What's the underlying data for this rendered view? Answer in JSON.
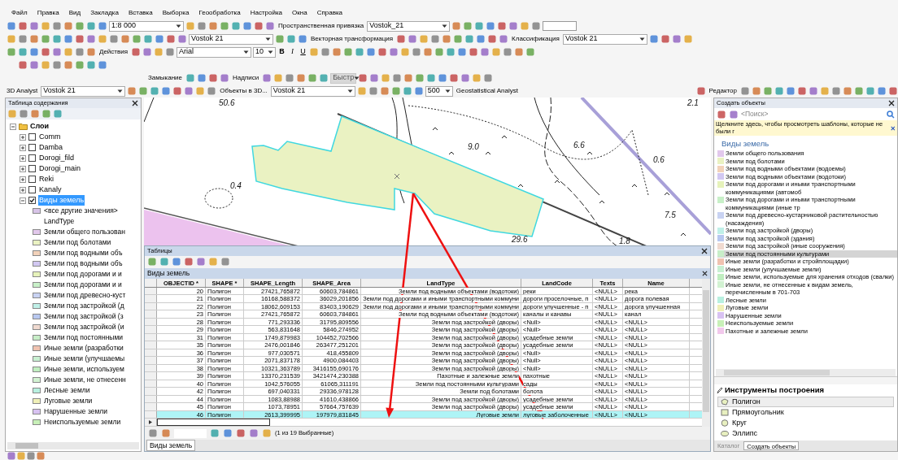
{
  "menu": [
    "Файл",
    "Правка",
    "Вид",
    "Закладка",
    "Вставка",
    "Выборка",
    "Геообработка",
    "Настройка",
    "Окна",
    "Справка"
  ],
  "toolbars": [
    {
      "items": [
        {
          "kind": "combo",
          "value": "1:8 000",
          "disabled": false
        },
        {
          "kind": "menu",
          "label": "Пространственная привязка"
        },
        {
          "kind": "combo",
          "value": "Vostok_21",
          "disabled": false
        }
      ]
    },
    {
      "items": [
        {
          "kind": "combo",
          "value": "Vostok 21",
          "disabled": false
        },
        {
          "kind": "menu",
          "label": "Векторная трансформация"
        },
        {
          "kind": "menu",
          "label": "Классификация"
        },
        {
          "kind": "combo",
          "value": "Vostok 21",
          "disabled": false
        }
      ]
    },
    {
      "items": [
        {
          "kind": "menu",
          "label": "Действия"
        },
        {
          "kind": "combo",
          "value": "Arial",
          "disabled": false
        },
        {
          "kind": "combo",
          "value": "10",
          "disabled": false
        },
        {
          "kind": "glyph",
          "text": "B"
        },
        {
          "kind": "glyph",
          "text": "I"
        },
        {
          "kind": "glyph",
          "text": "U"
        }
      ]
    },
    {
      "items": [
        {
          "kind": "menu",
          "label": "Замыкание"
        },
        {
          "kind": "menu",
          "label": "Надписи"
        },
        {
          "kind": "combo",
          "value": "Быстр",
          "disabled": true
        }
      ]
    },
    {
      "items": [
        {
          "kind": "menu",
          "label": "3D Analyst"
        },
        {
          "kind": "combo",
          "value": "Vostok 21",
          "disabled": false
        },
        {
          "kind": "menu",
          "label": "Объекты в 3D..."
        },
        {
          "kind": "combo",
          "value": "Vostok 21",
          "disabled": false
        },
        {
          "kind": "combo",
          "value": "500",
          "disabled": false
        },
        {
          "kind": "menu",
          "label": "Geostatistical Analyst"
        },
        {
          "kind": "menu",
          "label": "Редактор"
        }
      ]
    }
  ],
  "toc": {
    "title": "Таблица содержания",
    "root": "Слои",
    "expanded": true,
    "layers": [
      {
        "label": "Comm",
        "checked": false,
        "expanded": false,
        "selected": false
      },
      {
        "label": "Damba",
        "checked": false,
        "expanded": false,
        "selected": false
      },
      {
        "label": "Dorogi_fild",
        "checked": false,
        "expanded": false,
        "selected": false
      },
      {
        "label": "Dorogi_main",
        "checked": false,
        "expanded": false,
        "selected": false
      },
      {
        "label": "Reki",
        "checked": false,
        "expanded": false,
        "selected": false
      },
      {
        "label": "Kanaly",
        "checked": false,
        "expanded": false,
        "selected": false
      },
      {
        "label": "Виды земель",
        "checked": true,
        "expanded": true,
        "selected": true,
        "legend": [
          {
            "kind": "symbol",
            "label": "<все другие значения>",
            "color": "#d8c4e8"
          },
          {
            "kind": "heading",
            "label": "LandType"
          },
          {
            "kind": "symbol",
            "label": "Земли общего пользован",
            "color": "#e2c8ec"
          },
          {
            "kind": "symbol",
            "label": "Земли под болотами",
            "color": "#eaf2c2"
          },
          {
            "kind": "symbol",
            "label": "Земли под водными объ",
            "color": "#f2d2ba"
          },
          {
            "kind": "symbol",
            "label": "Земли под водными объ",
            "color": "#d2c8f2"
          },
          {
            "kind": "symbol",
            "label": "Земли под дорогами и и",
            "color": "#e6f2ba"
          },
          {
            "kind": "symbol",
            "label": "Земли под дорогами и и",
            "color": "#c8f0c8"
          },
          {
            "kind": "symbol",
            "label": "Земли под древесно-куст",
            "color": "#c8d2f2"
          },
          {
            "kind": "symbol",
            "label": "Земли под застройкой (д",
            "color": "#c0f0e8"
          },
          {
            "kind": "symbol",
            "label": "Земли под застройкой (з",
            "color": "#b8c8f0"
          },
          {
            "kind": "symbol",
            "label": "Земли под застройкой (и",
            "color": "#f0dad0"
          },
          {
            "kind": "symbol",
            "label": "Земли под постоянными",
            "color": "#c8eec8"
          },
          {
            "kind": "symbol",
            "label": "Иные земли (разработки",
            "color": "#f0c2b0"
          },
          {
            "kind": "symbol",
            "label": "Иные земли (улучшаемы",
            "color": "#c8f0d2"
          },
          {
            "kind": "symbol",
            "label": "Иные земли, используем",
            "color": "#c0eec0"
          },
          {
            "kind": "symbol",
            "label": "Иные земли, не отнесенн",
            "color": "#d2f2d2"
          },
          {
            "kind": "symbol",
            "label": "Лесные земли",
            "color": "#b8f0e0"
          },
          {
            "kind": "symbol",
            "label": "Луговые земли",
            "color": "#f0f0b8"
          },
          {
            "kind": "symbol",
            "label": "Нарушенные земли",
            "color": "#d8c2f2"
          },
          {
            "kind": "symbol",
            "label": "Неиспользуемые земли",
            "color": "#c8f0b8"
          }
        ]
      }
    ]
  },
  "map": {
    "labels": [
      "50.6",
      "9.0",
      "6.6",
      "0.6",
      "7.5",
      "29.6",
      "1.8",
      "2.1",
      "0.4"
    ]
  },
  "table": {
    "title": "Таблицы",
    "layer": "Виды земель",
    "columns": [
      "OBJECTID *",
      "SHAPE *",
      "SHAPE_Length",
      "SHAPE_Area",
      "LandType",
      "LandCode",
      "Texts",
      "Name"
    ],
    "rows": [
      {
        "selected": false,
        "cells": [
          "20",
          "Полигон",
          "27421,765872",
          "60603,784861",
          "Земли под водными объектами (водотоки)",
          "реки",
          "<NULL>",
          "река"
        ]
      },
      {
        "selected": false,
        "cells": [
          "21",
          "Полигон",
          "16168,588372",
          "36029,201856",
          "Земли под дорогами и иными транспортными коммуни",
          "дороги проселочные, п",
          "<NULL>",
          "дорога полевая"
        ]
      },
      {
        "selected": false,
        "cells": [
          "22",
          "Полигон",
          "18062,609153",
          "83403,190629",
          "Земли под дорогами и иными транспортными коммуни",
          "дороги улучшенные - п",
          "<NULL>",
          "дорога улучшенная"
        ]
      },
      {
        "selected": false,
        "cells": [
          "23",
          "Полигон",
          "27421,765872",
          "60603,784861",
          "Земли под водными объектами (водотоки)",
          "каналы и канавы",
          "<NULL>",
          "канал"
        ]
      },
      {
        "selected": false,
        "cells": [
          "28",
          "Полигон",
          "771,293336",
          "31795,809556",
          "Земли под застройкой (дворы)",
          "<Null>",
          "<NULL>",
          "<NULL>"
        ]
      },
      {
        "selected": false,
        "cells": [
          "29",
          "Полигон",
          "563,831648",
          "5846,274952",
          "Земли под застройкой (дворы)",
          "<Null>",
          "<NULL>",
          "<NULL>"
        ]
      },
      {
        "selected": false,
        "cells": [
          "31",
          "Полигон",
          "1749,879983",
          "104452,702566",
          "Земли под застройкой (дворы)",
          "усадебные земли",
          "<NULL>",
          "<NULL>"
        ]
      },
      {
        "selected": false,
        "cells": [
          "35",
          "Полигон",
          "2476,001846",
          "263477,251201",
          "Земли под застройкой (дворы)",
          "усадебные земли",
          "<NULL>",
          "<NULL>"
        ]
      },
      {
        "selected": false,
        "cells": [
          "36",
          "Полигон",
          "977,030571",
          "418,455809",
          "Земли под застройкой (дворы)",
          "<Null>",
          "<NULL>",
          "<NULL>"
        ]
      },
      {
        "selected": false,
        "cells": [
          "37",
          "Полигон",
          "2071,837178",
          "4900,084403",
          "Земли под застройкой (дворы)",
          "<Null>",
          "<NULL>",
          "<NULL>"
        ]
      },
      {
        "selected": false,
        "cells": [
          "38",
          "Полигон",
          "10321,363789",
          "3416155,690176",
          "Земли под застройкой (дворы)",
          "<Null>",
          "<NULL>",
          "<NULL>"
        ]
      },
      {
        "selected": false,
        "cells": [
          "39",
          "Полигон",
          "13370,231539",
          "3421474,230388",
          "Пахотные и залежные земли",
          "пахотные",
          "<NULL>",
          "<NULL>"
        ]
      },
      {
        "selected": false,
        "cells": [
          "40",
          "Полигон",
          "1042,576055",
          "61065,311191",
          "Земли под постоянными культурами",
          "сады",
          "<NULL>",
          "<NULL>"
        ]
      },
      {
        "selected": false,
        "cells": [
          "42",
          "Полигон",
          "697,040331",
          "29336,978128",
          "Земли под болотами",
          "болота",
          "<NULL>",
          "<NULL>"
        ]
      },
      {
        "selected": false,
        "cells": [
          "44",
          "Полигон",
          "1083,88988",
          "41610,438866",
          "Земли под застройкой (дворы)",
          "усадебные земли",
          "<NULL>",
          "<NULL>"
        ]
      },
      {
        "selected": false,
        "cells": [
          "45",
          "Полигон",
          "1073,78951",
          "57664,757639",
          "Земли под застройкой (дворы)",
          "усадебные земли",
          "<NULL>",
          "<NULL>"
        ]
      },
      {
        "selected": true,
        "cells": [
          "46",
          "Полигон",
          "2613,399995",
          "197979,831845",
          "Луговые земли",
          "луговые заболоченные",
          "<NULL>",
          "<NULL>"
        ]
      }
    ],
    "status": "(1 из 19 Выбранные)",
    "bottom_tab": "Виды земель"
  },
  "create_features": {
    "title": "Создать объекты",
    "search": {
      "placeholder": "<Поиск>"
    },
    "hint": "Щелкните здесь, чтобы просмотреть шаблоны, которые не были г",
    "group": "Виды земель",
    "templates": [
      {
        "label": "Земли общего пользования",
        "color": "#e2c8ec",
        "selected": false
      },
      {
        "label": "Земли под болотами",
        "color": "#eaf2c2",
        "selected": false
      },
      {
        "label": "Земли под водными объектами (водоемы)",
        "color": "#f2d2ba",
        "selected": false
      },
      {
        "label": "Земли под водными объектами (водотоки)",
        "color": "#d2c8f2",
        "selected": false
      },
      {
        "label": "Земли под дорогами и иными транспортными коммуникациями (автомоб",
        "color": "#e6f2ba",
        "selected": false
      },
      {
        "label": "Земли под дорогами и иными транспортными коммуникациями (иные тр",
        "color": "#c8f0c8",
        "selected": false
      },
      {
        "label": "Земли под древесно-кустарниковой растительностью (насаждения)",
        "color": "#c8d2f2",
        "selected": false
      },
      {
        "label": "Земли под застройкой (дворы)",
        "color": "#c0f0e8",
        "selected": false
      },
      {
        "label": "Земли под застройкой (здания)",
        "color": "#b8c8f0",
        "selected": false
      },
      {
        "label": "Земли под застройкой (иные сооружения)",
        "color": "#f0dad0",
        "selected": false
      },
      {
        "label": "Земли под постоянными культурами",
        "color": "#c8eec8",
        "selected": true
      },
      {
        "label": "Иные земли (разработки и стройплощадки)",
        "color": "#f0c2b0",
        "selected": false
      },
      {
        "label": "Иные земли (улучшаемые земли)",
        "color": "#c8f0d2",
        "selected": false
      },
      {
        "label": "Иные земли, используемые для хранения отходов (свалки)",
        "color": "#c0eec0",
        "selected": false
      },
      {
        "label": "Иные земли, не отнесенные к видам земель, перечисленным в 701-703",
        "color": "#d2f2d2",
        "selected": false
      },
      {
        "label": "Лесные земли",
        "color": "#b8f0e0",
        "selected": false
      },
      {
        "label": "Луговые земли",
        "color": "#f0f0b8",
        "selected": false
      },
      {
        "label": "Нарушенные земли",
        "color": "#d8c2f2",
        "selected": false
      },
      {
        "label": "Неиспользуемые земли",
        "color": "#c8f0b8",
        "selected": false
      },
      {
        "label": "Пахотные и залежные земли",
        "color": "#f2c8ec",
        "selected": false
      }
    ],
    "tools_title": "Инструменты построения",
    "tools": [
      {
        "label": "Полигон",
        "kind": "polygon",
        "selected": true
      },
      {
        "label": "Прямоугольник",
        "kind": "rectangle",
        "selected": false
      },
      {
        "label": "Круг",
        "kind": "circle",
        "selected": false
      },
      {
        "label": "Эллипс",
        "kind": "ellipse",
        "selected": false
      }
    ],
    "tabs": [
      {
        "label": "Каталог",
        "selected": false
      },
      {
        "label": "Создать объекты",
        "selected": true
      }
    ]
  }
}
